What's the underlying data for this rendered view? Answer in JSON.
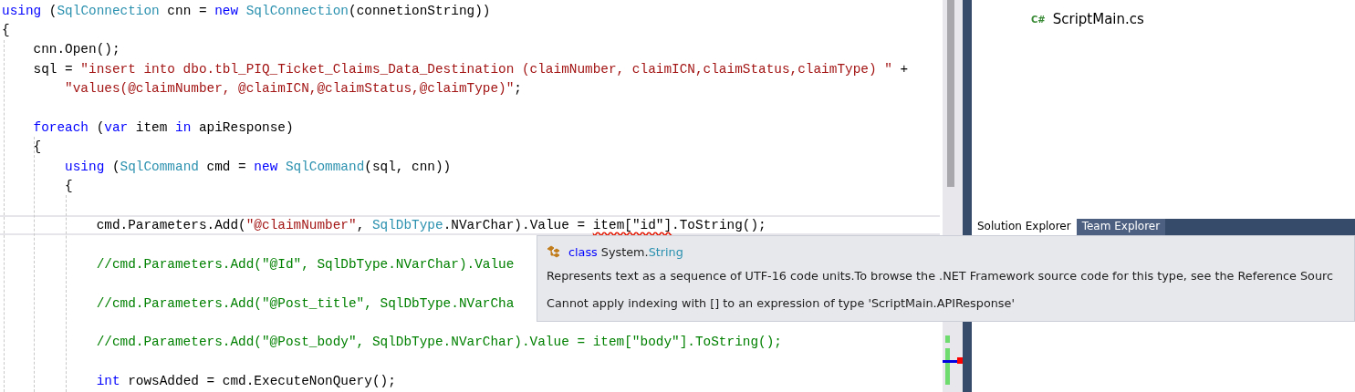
{
  "editor": {
    "lines": [
      {
        "current": false,
        "tokens": [
          {
            "kind": "kw",
            "text": "using"
          },
          {
            "kind": "plain",
            "text": " ("
          },
          {
            "kind": "type",
            "text": "SqlConnection"
          },
          {
            "kind": "plain",
            "text": " cnn = "
          },
          {
            "kind": "kw",
            "text": "new "
          },
          {
            "kind": "type",
            "text": "SqlConnection"
          },
          {
            "kind": "plain",
            "text": "(connetionString))"
          }
        ]
      },
      {
        "current": false,
        "tokens": [
          {
            "kind": "plain",
            "text": "{"
          }
        ]
      },
      {
        "current": false,
        "tokens": [
          {
            "kind": "plain",
            "text": "    cnn.Open();"
          }
        ]
      },
      {
        "current": false,
        "tokens": [
          {
            "kind": "plain",
            "text": "    sql = "
          },
          {
            "kind": "str",
            "text": "\"insert into dbo.tbl_PIQ_Ticket_Claims_Data_Destination (claimNumber, claimICN,claimStatus,claimType) \""
          },
          {
            "kind": "plain",
            "text": " +"
          }
        ]
      },
      {
        "current": false,
        "tokens": [
          {
            "kind": "str",
            "text": "        \"values(@claimNumber, @claimICN,@claimStatus,@claimType)\""
          },
          {
            "kind": "plain",
            "text": ";"
          }
        ]
      },
      {
        "current": false
      },
      {
        "current": false,
        "tokens": [
          {
            "kind": "kw",
            "text": "    foreach"
          },
          {
            "kind": "plain",
            "text": " ("
          },
          {
            "kind": "kw",
            "text": "var"
          },
          {
            "kind": "plain",
            "text": " item "
          },
          {
            "kind": "kw",
            "text": "in"
          },
          {
            "kind": "plain",
            "text": " apiResponse)"
          }
        ]
      },
      {
        "current": false,
        "tokens": [
          {
            "kind": "plain",
            "text": "    {"
          }
        ]
      },
      {
        "current": false,
        "tokens": [
          {
            "kind": "kw",
            "text": "        using"
          },
          {
            "kind": "plain",
            "text": " ("
          },
          {
            "kind": "type",
            "text": "SqlCommand"
          },
          {
            "kind": "plain",
            "text": " cmd = "
          },
          {
            "kind": "kw",
            "text": "new "
          },
          {
            "kind": "type",
            "text": "SqlCommand"
          },
          {
            "kind": "plain",
            "text": "(sql, cnn))"
          }
        ]
      },
      {
        "current": false,
        "tokens": [
          {
            "kind": "plain",
            "text": "        {"
          }
        ]
      },
      {
        "current": false
      },
      {
        "current": true,
        "tokens": [
          {
            "kind": "plain",
            "text": "            cmd.Parameters.Add("
          },
          {
            "kind": "str",
            "text": "\"@claimNumber\""
          },
          {
            "kind": "plain",
            "text": ", "
          },
          {
            "kind": "type",
            "text": "SqlDbType"
          },
          {
            "kind": "plain",
            "text": ".NVarChar).Value = "
          },
          {
            "kind": "error",
            "text": "item[\"id\"]"
          },
          {
            "kind": "plain",
            "text": ".ToString();"
          }
        ]
      },
      {
        "current": false
      },
      {
        "current": false,
        "tokens": [
          {
            "kind": "comment",
            "text": "            //cmd.Parameters.Add(\"@Id\", SqlDbType.NVarChar).Value"
          }
        ]
      },
      {
        "current": false
      },
      {
        "current": false,
        "tokens": [
          {
            "kind": "comment",
            "text": "            //cmd.Parameters.Add(\"@Post_title\", SqlDbType.NVarCha"
          }
        ]
      },
      {
        "current": false
      },
      {
        "current": false,
        "tokens": [
          {
            "kind": "comment",
            "text": "            //cmd.Parameters.Add(\"@Post_body\", SqlDbType.NVarChar).Value = item[\"body\"].ToString();"
          }
        ]
      },
      {
        "current": false
      },
      {
        "current": false,
        "tokens": [
          {
            "kind": "kw",
            "text": "            int"
          },
          {
            "kind": "plain",
            "text": " rowsAdded = cmd.ExecuteNonQuery();"
          }
        ]
      }
    ]
  },
  "solution_explorer": {
    "items": [
      {
        "label": "ScriptMain.cs",
        "badge": "C#"
      }
    ],
    "tabs": [
      {
        "label": "Solution Explorer",
        "selected": true
      },
      {
        "label": "Team Explorer",
        "selected": false
      }
    ]
  },
  "tooltip": {
    "signature": [
      {
        "kind": "kw",
        "text": "class"
      },
      {
        "kind": "plain",
        "text": " System."
      },
      {
        "kind": "type",
        "text": "String"
      }
    ],
    "description": "Represents text as a sequence of UTF-16 code units.To browse the .NET Framework source code for this type, see the Reference Sourc",
    "error": "Cannot apply indexing with [] to an expression of type 'ScriptMain.APIResponse'"
  }
}
